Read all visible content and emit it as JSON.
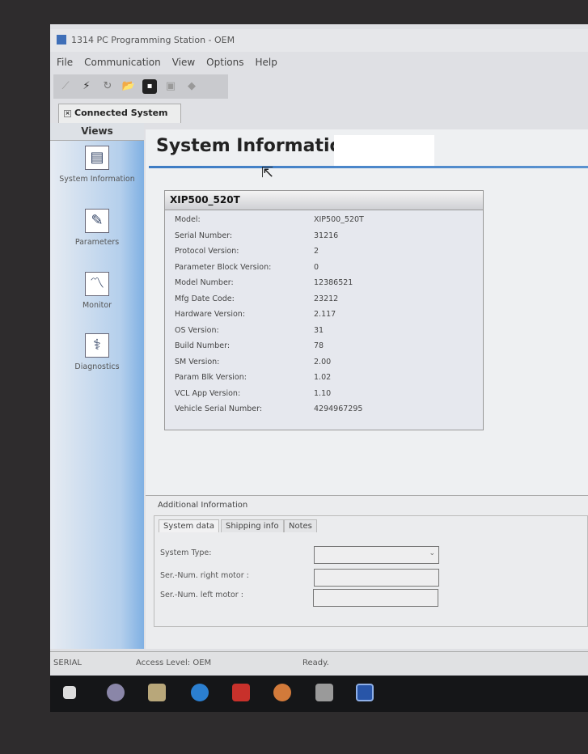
{
  "window": {
    "title": "1314 PC Programming Station - OEM"
  },
  "menu": [
    "File",
    "Communication",
    "View",
    "Options",
    "Help"
  ],
  "toolbar": {
    "icons": [
      "connect-icon",
      "disconnect-icon",
      "refresh-icon",
      "open-folder-icon",
      "save-icon",
      "print-icon",
      "diamond-icon"
    ]
  },
  "doc_tab": "Connected System",
  "sidebar": {
    "header": "Views",
    "items": [
      {
        "label": "System Information"
      },
      {
        "label": "Parameters"
      },
      {
        "label": "Monitor"
      },
      {
        "label": "Diagnostics"
      }
    ]
  },
  "page_title": "System Information",
  "info": {
    "header": "XIP500_520T",
    "rows": [
      {
        "label": "Model:",
        "value": "XIP500_520T"
      },
      {
        "label": "Serial Number:",
        "value": "31216"
      },
      {
        "label": "Protocol Version:",
        "value": "2"
      },
      {
        "label": "Parameter Block Version:",
        "value": "0"
      },
      {
        "label": "Model Number:",
        "value": "12386521"
      },
      {
        "label": "Mfg Date Code:",
        "value": "23212"
      },
      {
        "label": "Hardware Version:",
        "value": "2.117"
      },
      {
        "label": "OS Version:",
        "value": "31"
      },
      {
        "label": "Build Number:",
        "value": "78"
      },
      {
        "label": "SM Version:",
        "value": "2.00"
      },
      {
        "label": "Param Blk Version:",
        "value": "1.02"
      },
      {
        "label": "VCL App Version:",
        "value": "1.10"
      },
      {
        "label": "Vehicle Serial Number:",
        "value": "4294967295"
      }
    ]
  },
  "additional": {
    "label": "Additional Information",
    "tabs": [
      "System data",
      "Shipping info",
      "Notes"
    ],
    "fields": [
      {
        "label": "System Type:",
        "value": ""
      },
      {
        "label": "Ser.-Num. right motor :",
        "value": ""
      },
      {
        "label": "Ser.-Num. left motor :",
        "value": ""
      }
    ]
  },
  "status": {
    "port": "SERIAL",
    "access": "Access Level: OEM",
    "state": "Ready."
  }
}
